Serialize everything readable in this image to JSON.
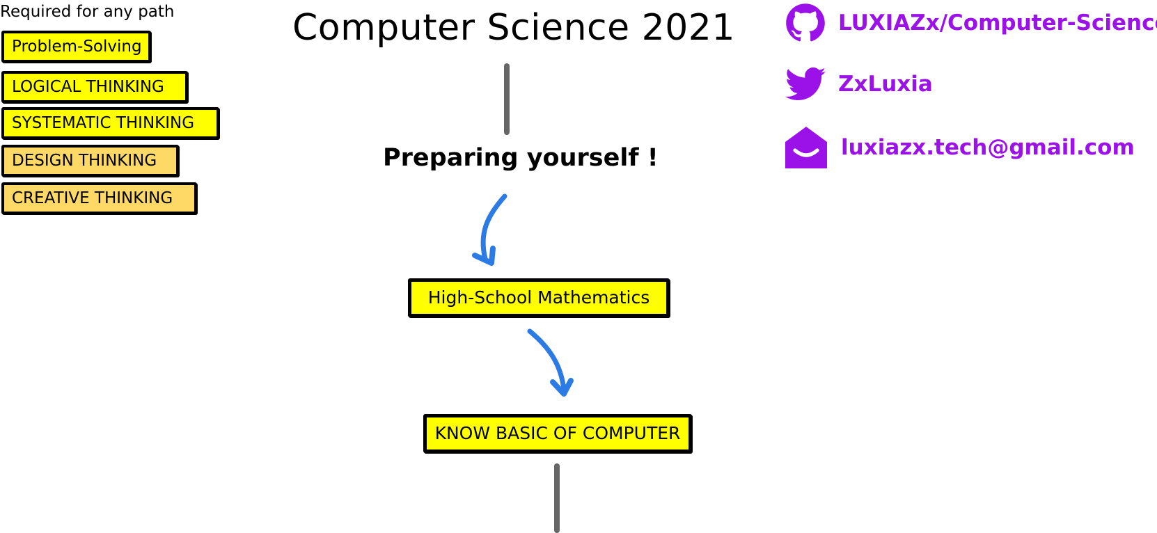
{
  "colors": {
    "skill_yellow": "#ffff00",
    "skill_orange": "#ffd966",
    "node_yellow": "#ffff00",
    "arrow_blue": "#2c7be5",
    "connector_gray": "#666666",
    "social_purple": "#9b12e8"
  },
  "required": {
    "label": "Required for any path",
    "items": [
      {
        "label": "Problem-Solving",
        "color": "#ffff00"
      },
      {
        "label": "LOGICAL THINKING",
        "color": "#ffff00"
      },
      {
        "label": "SYSTEMATIC THINKING",
        "color": "#ffff00"
      },
      {
        "label": "DESIGN THINKING",
        "color": "#ffd966"
      },
      {
        "label": "CREATIVE THINKING",
        "color": "#ffd966"
      }
    ]
  },
  "roadmap": {
    "title": "Computer Science 2021",
    "subtitle": "Preparing yourself !",
    "nodes": [
      {
        "label": "High-School Mathematics"
      },
      {
        "label": "KNOW BASIC OF COMPUTER"
      }
    ]
  },
  "social": {
    "github": {
      "icon": "github-icon",
      "text": "LUXIAZx/Computer-Sciences"
    },
    "twitter": {
      "icon": "twitter-icon",
      "text": "ZxLuxia"
    },
    "email": {
      "icon": "envelope-icon",
      "text": "luxiazx.tech@gmail.com"
    }
  }
}
